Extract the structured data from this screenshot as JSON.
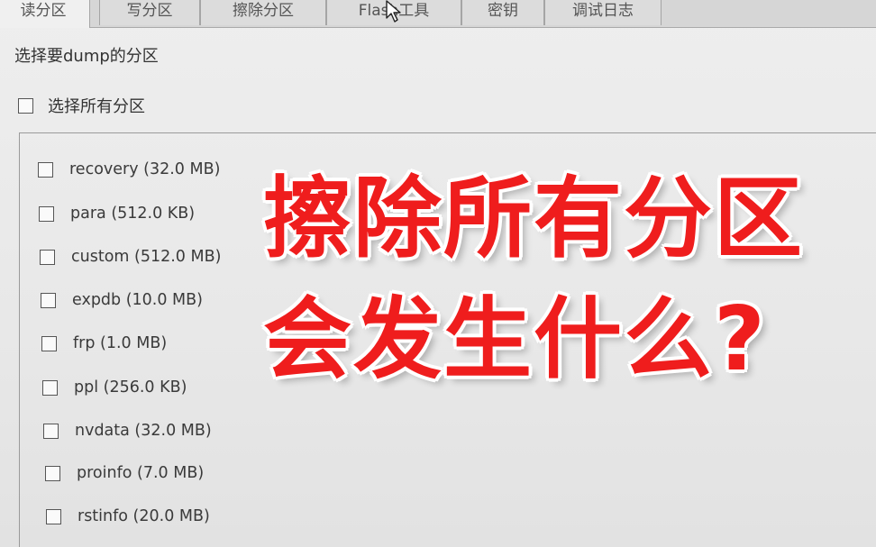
{
  "tabs": [
    {
      "label": "读分区",
      "active": true
    },
    {
      "label": "写分区",
      "active": false
    },
    {
      "label": "擦除分区",
      "active": false
    },
    {
      "label": "Flash工具",
      "active": false
    },
    {
      "label": "密钥",
      "active": false
    },
    {
      "label": "调试日志",
      "active": false
    }
  ],
  "panel": {
    "section_title": "选择要dump的分区",
    "select_all_label": "选择所有分区",
    "partitions": [
      {
        "label": "recovery (32.0 MB)",
        "checked": false
      },
      {
        "label": "para (512.0 KB)",
        "checked": false
      },
      {
        "label": "custom (512.0 MB)",
        "checked": false
      },
      {
        "label": "expdb (10.0 MB)",
        "checked": false
      },
      {
        "label": "frp (1.0 MB)",
        "checked": false
      },
      {
        "label": "ppl (256.0 KB)",
        "checked": false
      },
      {
        "label": "nvdata (32.0 MB)",
        "checked": false
      },
      {
        "label": "proinfo (7.0 MB)",
        "checked": false
      },
      {
        "label": "rstinfo (20.0 MB)",
        "checked": false
      }
    ]
  },
  "overlay": {
    "line1": "擦除所有分区",
    "line2": "会发生什么?",
    "color": "#ef1d1d",
    "outline_color": "#ffffff"
  }
}
